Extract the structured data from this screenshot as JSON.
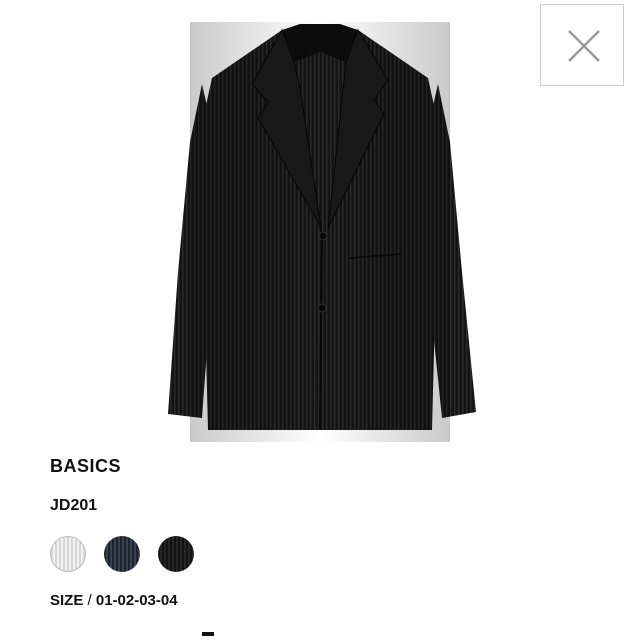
{
  "close_icon": "close-x-icon",
  "product": {
    "image_icon": "black-pleated-jacket",
    "brand": "BASICS",
    "sku": "JD201",
    "swatches": [
      {
        "name": "light-gray",
        "color": "#d9d9d9"
      },
      {
        "name": "navy",
        "color": "#2a3140"
      },
      {
        "name": "black",
        "color": "#1a1a1a"
      }
    ],
    "size_label": "SIZE",
    "size_separator": " / ",
    "size_values": "01-02-03-04"
  }
}
